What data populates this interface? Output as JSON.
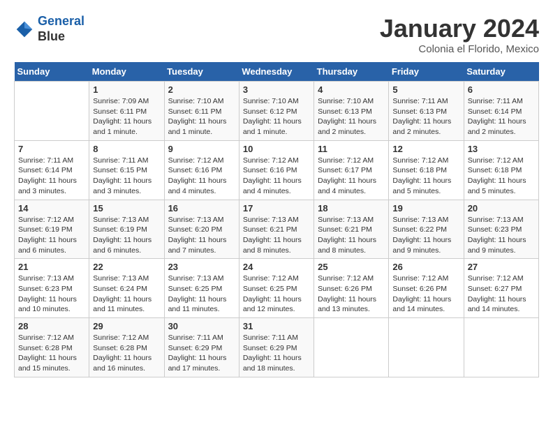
{
  "header": {
    "logo_line1": "General",
    "logo_line2": "Blue",
    "month": "January 2024",
    "location": "Colonia el Florido, Mexico"
  },
  "days_of_week": [
    "Sunday",
    "Monday",
    "Tuesday",
    "Wednesday",
    "Thursday",
    "Friday",
    "Saturday"
  ],
  "weeks": [
    [
      {
        "day": "",
        "info": ""
      },
      {
        "day": "1",
        "info": "Sunrise: 7:09 AM\nSunset: 6:11 PM\nDaylight: 11 hours\nand 1 minute."
      },
      {
        "day": "2",
        "info": "Sunrise: 7:10 AM\nSunset: 6:11 PM\nDaylight: 11 hours\nand 1 minute."
      },
      {
        "day": "3",
        "info": "Sunrise: 7:10 AM\nSunset: 6:12 PM\nDaylight: 11 hours\nand 1 minute."
      },
      {
        "day": "4",
        "info": "Sunrise: 7:10 AM\nSunset: 6:13 PM\nDaylight: 11 hours\nand 2 minutes."
      },
      {
        "day": "5",
        "info": "Sunrise: 7:11 AM\nSunset: 6:13 PM\nDaylight: 11 hours\nand 2 minutes."
      },
      {
        "day": "6",
        "info": "Sunrise: 7:11 AM\nSunset: 6:14 PM\nDaylight: 11 hours\nand 2 minutes."
      }
    ],
    [
      {
        "day": "7",
        "info": "Sunrise: 7:11 AM\nSunset: 6:14 PM\nDaylight: 11 hours\nand 3 minutes."
      },
      {
        "day": "8",
        "info": "Sunrise: 7:11 AM\nSunset: 6:15 PM\nDaylight: 11 hours\nand 3 minutes."
      },
      {
        "day": "9",
        "info": "Sunrise: 7:12 AM\nSunset: 6:16 PM\nDaylight: 11 hours\nand 4 minutes."
      },
      {
        "day": "10",
        "info": "Sunrise: 7:12 AM\nSunset: 6:16 PM\nDaylight: 11 hours\nand 4 minutes."
      },
      {
        "day": "11",
        "info": "Sunrise: 7:12 AM\nSunset: 6:17 PM\nDaylight: 11 hours\nand 4 minutes."
      },
      {
        "day": "12",
        "info": "Sunrise: 7:12 AM\nSunset: 6:18 PM\nDaylight: 11 hours\nand 5 minutes."
      },
      {
        "day": "13",
        "info": "Sunrise: 7:12 AM\nSunset: 6:18 PM\nDaylight: 11 hours\nand 5 minutes."
      }
    ],
    [
      {
        "day": "14",
        "info": "Sunrise: 7:12 AM\nSunset: 6:19 PM\nDaylight: 11 hours\nand 6 minutes."
      },
      {
        "day": "15",
        "info": "Sunrise: 7:13 AM\nSunset: 6:19 PM\nDaylight: 11 hours\nand 6 minutes."
      },
      {
        "day": "16",
        "info": "Sunrise: 7:13 AM\nSunset: 6:20 PM\nDaylight: 11 hours\nand 7 minutes."
      },
      {
        "day": "17",
        "info": "Sunrise: 7:13 AM\nSunset: 6:21 PM\nDaylight: 11 hours\nand 8 minutes."
      },
      {
        "day": "18",
        "info": "Sunrise: 7:13 AM\nSunset: 6:21 PM\nDaylight: 11 hours\nand 8 minutes."
      },
      {
        "day": "19",
        "info": "Sunrise: 7:13 AM\nSunset: 6:22 PM\nDaylight: 11 hours\nand 9 minutes."
      },
      {
        "day": "20",
        "info": "Sunrise: 7:13 AM\nSunset: 6:23 PM\nDaylight: 11 hours\nand 9 minutes."
      }
    ],
    [
      {
        "day": "21",
        "info": "Sunrise: 7:13 AM\nSunset: 6:23 PM\nDaylight: 11 hours\nand 10 minutes."
      },
      {
        "day": "22",
        "info": "Sunrise: 7:13 AM\nSunset: 6:24 PM\nDaylight: 11 hours\nand 11 minutes."
      },
      {
        "day": "23",
        "info": "Sunrise: 7:13 AM\nSunset: 6:25 PM\nDaylight: 11 hours\nand 11 minutes."
      },
      {
        "day": "24",
        "info": "Sunrise: 7:12 AM\nSunset: 6:25 PM\nDaylight: 11 hours\nand 12 minutes."
      },
      {
        "day": "25",
        "info": "Sunrise: 7:12 AM\nSunset: 6:26 PM\nDaylight: 11 hours\nand 13 minutes."
      },
      {
        "day": "26",
        "info": "Sunrise: 7:12 AM\nSunset: 6:26 PM\nDaylight: 11 hours\nand 14 minutes."
      },
      {
        "day": "27",
        "info": "Sunrise: 7:12 AM\nSunset: 6:27 PM\nDaylight: 11 hours\nand 14 minutes."
      }
    ],
    [
      {
        "day": "28",
        "info": "Sunrise: 7:12 AM\nSunset: 6:28 PM\nDaylight: 11 hours\nand 15 minutes."
      },
      {
        "day": "29",
        "info": "Sunrise: 7:12 AM\nSunset: 6:28 PM\nDaylight: 11 hours\nand 16 minutes."
      },
      {
        "day": "30",
        "info": "Sunrise: 7:11 AM\nSunset: 6:29 PM\nDaylight: 11 hours\nand 17 minutes."
      },
      {
        "day": "31",
        "info": "Sunrise: 7:11 AM\nSunset: 6:29 PM\nDaylight: 11 hours\nand 18 minutes."
      },
      {
        "day": "",
        "info": ""
      },
      {
        "day": "",
        "info": ""
      },
      {
        "day": "",
        "info": ""
      }
    ]
  ]
}
